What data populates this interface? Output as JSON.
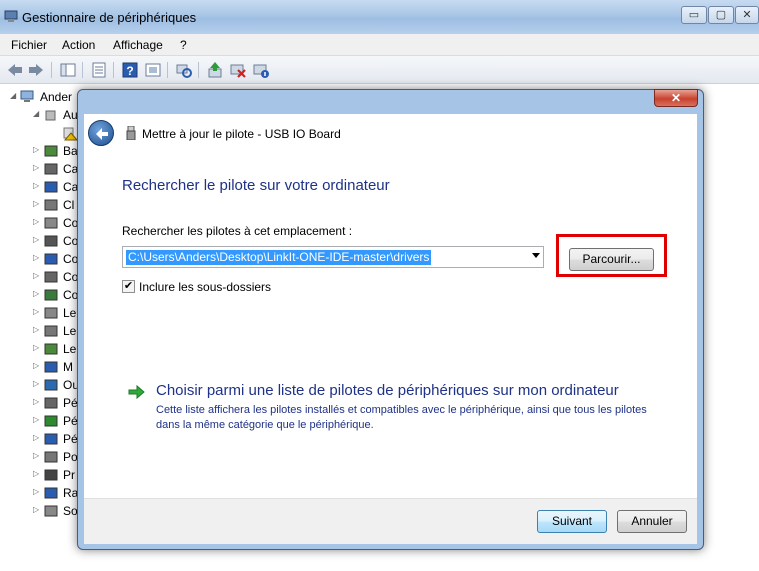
{
  "window": {
    "title": "Gestionnaire de périphériques",
    "minimize": "▭",
    "maximize": "▢",
    "close": "✕"
  },
  "menu": {
    "items": [
      "Fichier",
      "Action",
      "Affichage",
      "?"
    ]
  },
  "tree": {
    "root": "Ander",
    "child_visible": "Au",
    "items": [
      "Ba",
      "Ca",
      "Ca",
      "Cl",
      "Co",
      "Co",
      "Co",
      "Co",
      "Co",
      "Le",
      "Le",
      "Le",
      "M",
      "Ou",
      "Pé",
      "Pé",
      "Pé",
      "Po",
      "Pr",
      "Ra",
      "So"
    ]
  },
  "dialog": {
    "close": "✕",
    "header_title": "Mettre à jour le pilote - USB IO Board",
    "heading": "Rechercher le pilote sur votre ordinateur",
    "location_label": "Rechercher les pilotes à cet emplacement :",
    "path_value": "C:\\Users\\Anders\\Desktop\\LinkIt-ONE-IDE-master\\drivers",
    "browse_label": "Parcourir...",
    "include_subfolders_label": "Inclure les sous-dossiers",
    "include_subfolders_checked": true,
    "choose_title": "Choisir parmi une liste de pilotes de périphériques sur mon ordinateur",
    "choose_desc": "Cette liste affichera les pilotes installés et compatibles avec le périphérique, ainsi que tous les pilotes dans la même catégorie que le périphérique.",
    "next_label": "Suivant",
    "cancel_label": "Annuler"
  },
  "colors": {
    "link_blue": "#1e3287",
    "highlight_red": "#e00000",
    "selection_blue": "#3399ff"
  }
}
